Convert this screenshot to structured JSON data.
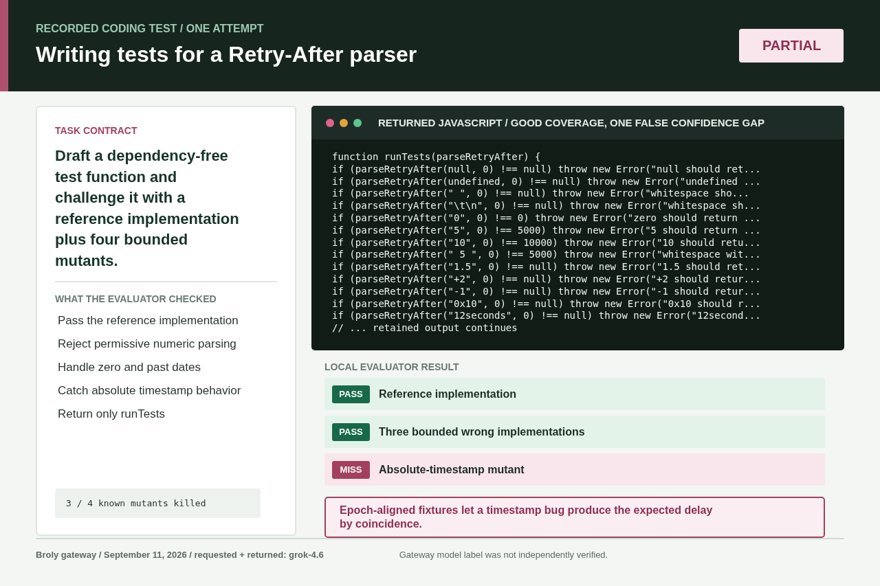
{
  "header": {
    "eyebrow": "RECORDED CODING TEST / ONE ATTEMPT",
    "title": "Writing tests for a Retry-After parser",
    "status": "PARTIAL"
  },
  "contract": {
    "label": "TASK CONTRACT",
    "summary": "Draft a dependency-free test function and challenge it with a reference implementation plus four bounded mutants.",
    "checks_label": "WHAT THE EVALUATOR CHECKED",
    "checks": [
      "Pass the reference implementation",
      "Reject permissive numeric parsing",
      "Handle zero and past dates",
      "Catch absolute timestamp behavior",
      "Return only runTests"
    ],
    "score": "3 / 4 known mutants killed"
  },
  "code_panel": {
    "title": "RETURNED JAVASCRIPT / GOOD COVERAGE, ONE FALSE CONFIDENCE GAP",
    "lines": [
      "function runTests(parseRetryAfter) {",
      "if (parseRetryAfter(null, 0) !== null) throw new Error(\"null should ret...",
      "if (parseRetryAfter(undefined, 0) !== null) throw new Error(\"undefined ...",
      "if (parseRetryAfter(\" \", 0) !== null) throw new Error(\"whitespace sho...",
      "if (parseRetryAfter(\"\\t\\n\", 0) !== null) throw new Error(\"whitespace sh...",
      "if (parseRetryAfter(\"0\", 0) !== 0) throw new Error(\"zero should return ...",
      "if (parseRetryAfter(\"5\", 0) !== 5000) throw new Error(\"5 should return ...",
      "if (parseRetryAfter(\"10\", 0) !== 10000) throw new Error(\"10 should retu...",
      "if (parseRetryAfter(\" 5 \", 0) !== 5000) throw new Error(\"whitespace wit...",
      "if (parseRetryAfter(\"1.5\", 0) !== null) throw new Error(\"1.5 should ret...",
      "if (parseRetryAfter(\"+2\", 0) !== null) throw new Error(\"+2 should retur...",
      "if (parseRetryAfter(\"-1\", 0) !== null) throw new Error(\"-1 should retur...",
      "if (parseRetryAfter(\"0x10\", 0) !== null) throw new Error(\"0x10 should r...",
      "if (parseRetryAfter(\"12seconds\", 0) !== null) throw new Error(\"12second...",
      "// ... retained output continues"
    ]
  },
  "results": {
    "label": "LOCAL EVALUATOR RESULT",
    "items": [
      {
        "kind": "pass",
        "badge": "PASS",
        "text": "Reference implementation"
      },
      {
        "kind": "pass",
        "badge": "PASS",
        "text": "Three bounded wrong implementations"
      },
      {
        "kind": "miss",
        "badge": "MISS",
        "text": "Absolute-timestamp mutant"
      }
    ],
    "note": "Epoch-aligned fixtures let a timestamp bug produce the expected delay by coincidence."
  },
  "footer": {
    "source": "Broly gateway / September 11, 2026 / requested + returned: grok-4.6",
    "disclaimer": "Gateway model label was not independently verified."
  }
}
